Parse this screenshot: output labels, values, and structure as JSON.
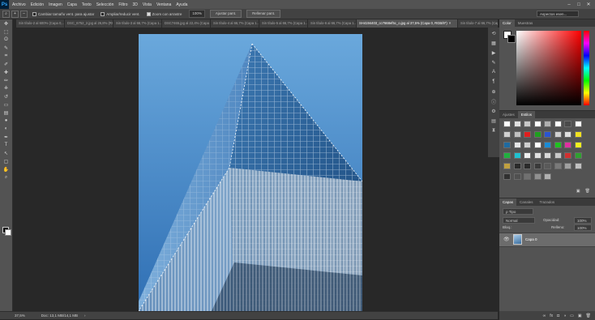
{
  "app": {
    "logo": "Ps"
  },
  "menu": [
    "Archivo",
    "Edición",
    "Imagen",
    "Capa",
    "Texto",
    "Selección",
    "Filtro",
    "3D",
    "Vista",
    "Ventana",
    "Ayuda"
  ],
  "window_controls": {
    "minimize": "–",
    "maximize": "□",
    "close": "✕"
  },
  "options": {
    "zoom_in_icon": "+",
    "zoom_out_icon": "–",
    "resize_windows_label": "Cambiar tamaño vent. para ajustar",
    "resize_windows_checked": false,
    "zoom_all_label": "Ampliar/reducir vent.",
    "zoom_all_checked": false,
    "scrubby_label": "Zoom con arrastre",
    "scrubby_checked": true,
    "zoom_value": "100%",
    "fit_screen_label": "Ajustar pant.",
    "fill_screen_label": "Rellenar pant.",
    "workspace": "Aspectos esen..."
  },
  "tabs": [
    {
      "label": "Sin título-2 al 600% (Capa 0,...",
      "active": false
    },
    {
      "label": "DSC_6752_2.jpg al 26,8% (RG...",
      "active": false
    },
    {
      "label": "Sin título-3 al 66,7% (Capa 1...",
      "active": false
    },
    {
      "label": "DSC7465.jpg al 22,4% (Capa 0...",
      "active": false
    },
    {
      "label": "Sin título-4 al 66,7% (Capa 1...",
      "active": false
    },
    {
      "label": "Sin título-5 al 66,7% (Capa 1...",
      "active": false
    },
    {
      "label": "Sin título-6 al 66,7% (Capa 1...",
      "active": false
    },
    {
      "label": "SH4194403_cc7668ef5c_o.jpg al 37,5% (Capa 0, RGB/8*)",
      "active": true
    },
    {
      "label": "Sin título-7 al 66,7% (Capa 1...",
      "active": false
    },
    {
      "label": "Sin título-8 al 66,7% (Capa 1...",
      "active": false
    }
  ],
  "tools": [
    "move-tool",
    "marquee-tool",
    "lasso-tool",
    "quick-select-tool",
    "crop-tool",
    "eyedropper-tool",
    "healing-tool",
    "brush-tool",
    "stamp-tool",
    "history-brush-tool",
    "eraser-tool",
    "gradient-tool",
    "blur-tool",
    "dodge-tool",
    "pen-tool",
    "type-tool",
    "path-select-tool",
    "shape-tool",
    "hand-tool",
    "zoom-tool"
  ],
  "tool_glyphs": [
    "✥",
    "⬚",
    "ʘ",
    "✎",
    "⌗",
    "✐",
    "✚",
    "✏",
    "⎈",
    "↺",
    "▭",
    "▤",
    "●",
    "◐",
    "✒",
    "T",
    "↖",
    "▢",
    "✋",
    "⌕"
  ],
  "status": {
    "zoom": "37,5%",
    "doc": "Doc: 13,1 MB/14,1 MB",
    "arrow": "›"
  },
  "panels": {
    "color_tab": "Color",
    "swatches_tab": "Muestras",
    "adjustments_tab": "Ajustes",
    "styles_tab": "Estilos",
    "layers_tab": "Capas",
    "channels_tab": "Canales",
    "paths_tab": "Trazados",
    "kind_label": "ρ Tipo",
    "blend_mode": "Normal",
    "opacity_label": "Opacidad:",
    "opacity_value": "100%",
    "lock_label": "Bloq.:",
    "fill_label": "Relleno:",
    "fill_value": "100%",
    "layer_name": "Capa 0",
    "styles_colors": [
      "#ffffff",
      "#e0e0e0",
      "#c8c8c8",
      "#ffffff",
      "#b0b0b0",
      "#ffffff",
      "#4a4a4a",
      "#ffffff",
      "#d0d0d0",
      "#c0c0c0",
      "#e01f1f",
      "#1f9f1f",
      "#2a55d0",
      "#d0d0d0",
      "#e0e0e0",
      "#f0e020",
      "#1f6aa0",
      "#e6e6e6",
      "#d0d0d0",
      "#ffffff",
      "#1a8bd5",
      "#20c020",
      "#e030a0",
      "#f0f020",
      "#20b040",
      "#20c0d0",
      "#f0f0f0",
      "#e0e0e0",
      "#d8d8d8",
      "#c8c8c8",
      "#d03030",
      "#30a030",
      "#c0a040",
      "#2a2a2a",
      "#2a2a2a",
      "#3a3a3a",
      "#5a5a5a",
      "#7a7a7a",
      "#a0a0a0",
      "#c0c0c0",
      "#303030",
      "#505050",
      "#707070",
      "#909090",
      "#b0b0b0"
    ]
  }
}
